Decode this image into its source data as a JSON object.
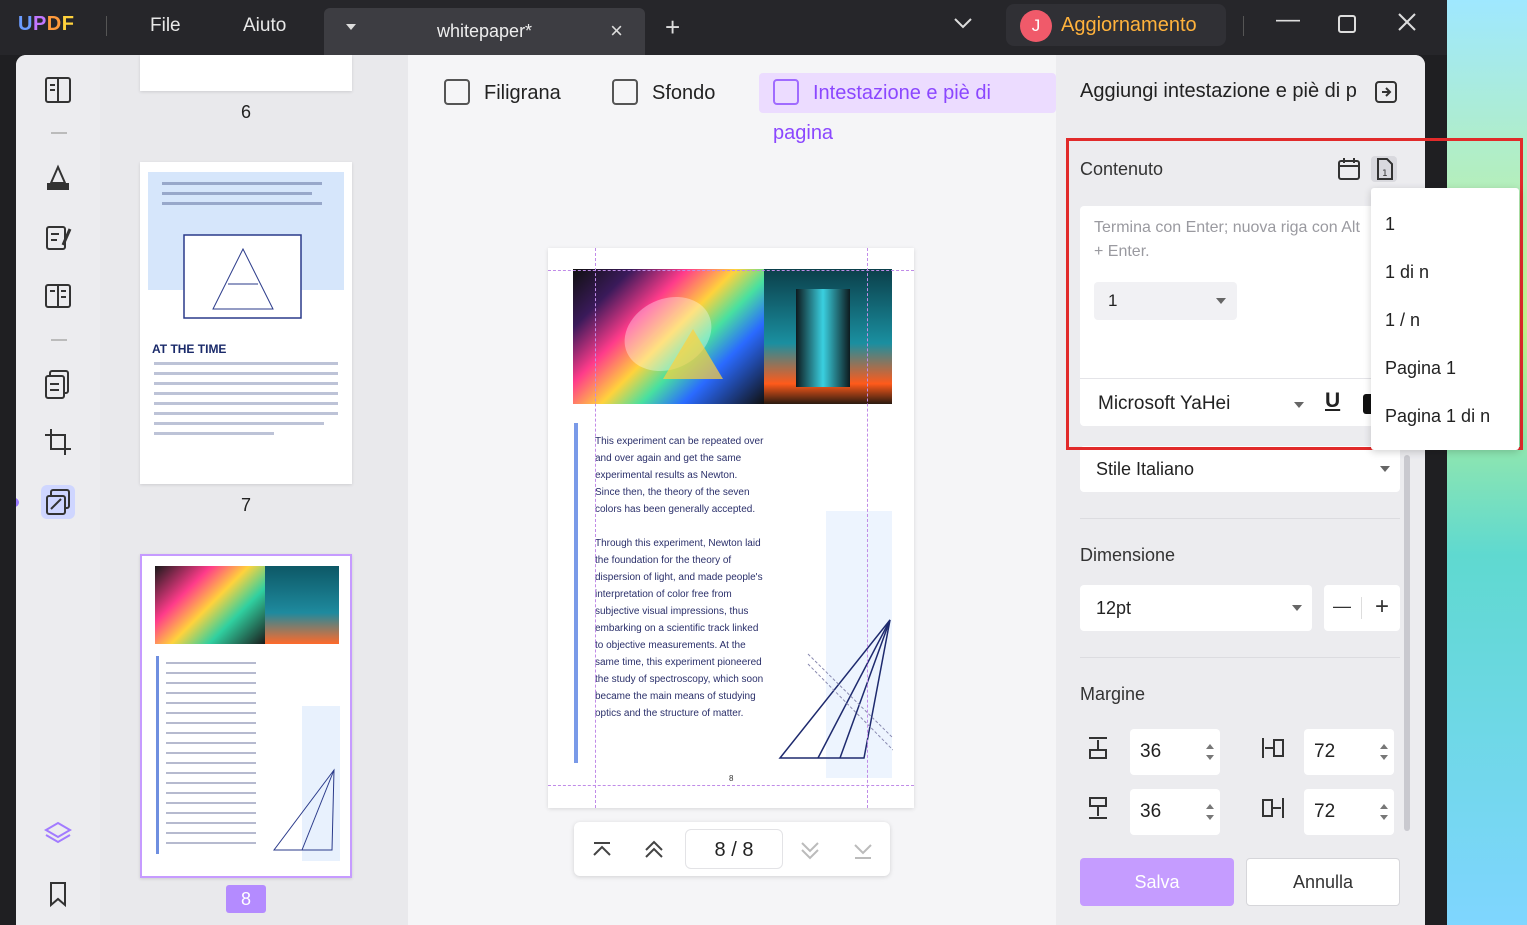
{
  "app": {
    "logo": "UPDF"
  },
  "menu": {
    "file": "File",
    "help": "Aiuto"
  },
  "tab": {
    "name": "whitepaper*"
  },
  "update": {
    "avatar_letter": "J",
    "label": "Aggiornamento"
  },
  "thumbnails": [
    {
      "page": "6"
    },
    {
      "page": "7",
      "heading": "AT THE TIME"
    },
    {
      "page": "8"
    }
  ],
  "toolbar": {
    "watermark": "Filigrana",
    "background": "Sfondo",
    "header_footer": "Intestazione e piè di pagina"
  },
  "page_preview": {
    "paragraph_1": "This experiment can be repeated over and over again and get the same experimental results as Newton. Since then, the theory of the seven colors has been generally accepted.",
    "paragraph_2": "Through this experiment, Newton laid the foundation for the theory of dispersion of light, and made people's interpretation of color free from subjective visual impressions, thus embarking on a scientific track linked to objective measurements. At the same time, this experiment pioneered the study of spectroscopy, which soon became the main means of studying optics and the structure of matter.",
    "footer_number": "8"
  },
  "pager": {
    "current": "8 / 8"
  },
  "panel": {
    "title": "Aggiungi intestazione e piè di p",
    "content_label": "Contenuto",
    "text_placeholder": "Termina con Enter; nuova riga con Alt + Enter.",
    "page_format_value": "1",
    "font": "Microsoft YaHei",
    "underline": "U",
    "style": "Stile Italiano",
    "size_label": "Dimensione",
    "size_value": "12pt",
    "minus": "—",
    "plus": "+",
    "margin_label": "Margine",
    "margins": {
      "top": "36",
      "bottom": "36",
      "left": "72",
      "right": "72"
    },
    "save": "Salva",
    "cancel": "Annulla"
  },
  "page_number_dropdown": {
    "options": [
      "1",
      "1 di n",
      "1 / n",
      "Pagina 1",
      "Pagina 1 di n"
    ]
  }
}
